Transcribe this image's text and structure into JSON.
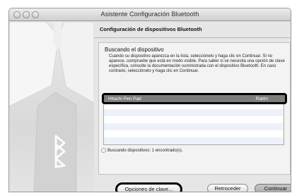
{
  "window": {
    "title": "Asistente Configuración Bluetooth"
  },
  "main": {
    "heading": "Configuración de dispositivos Bluetooth",
    "panel_title": "Buscando el dispositivo",
    "instructions": "Cuando su dispositivo aparezca en la lista, selecciónelo y haga clic en Continuar. Si no aparece, compruebe que está en modo visible. Para saber si se necesita una opción de clave específica, consulte la documentación suministrada con el dispositivo Bluetooth. En caso contrario, selecciónelo y haga clic en Continuar.",
    "devices": [
      {
        "name": "Hitachi Pen Pad",
        "type": "Ratón"
      }
    ],
    "status": "Buscando dispositivos: 1 encontrado(s)."
  },
  "buttons": {
    "options": "Opciones de clave...",
    "back": "Retroceder",
    "continue": "Continuar"
  },
  "icons": {
    "bluetooth": "bluetooth-icon",
    "spinner": "spinner-icon"
  }
}
